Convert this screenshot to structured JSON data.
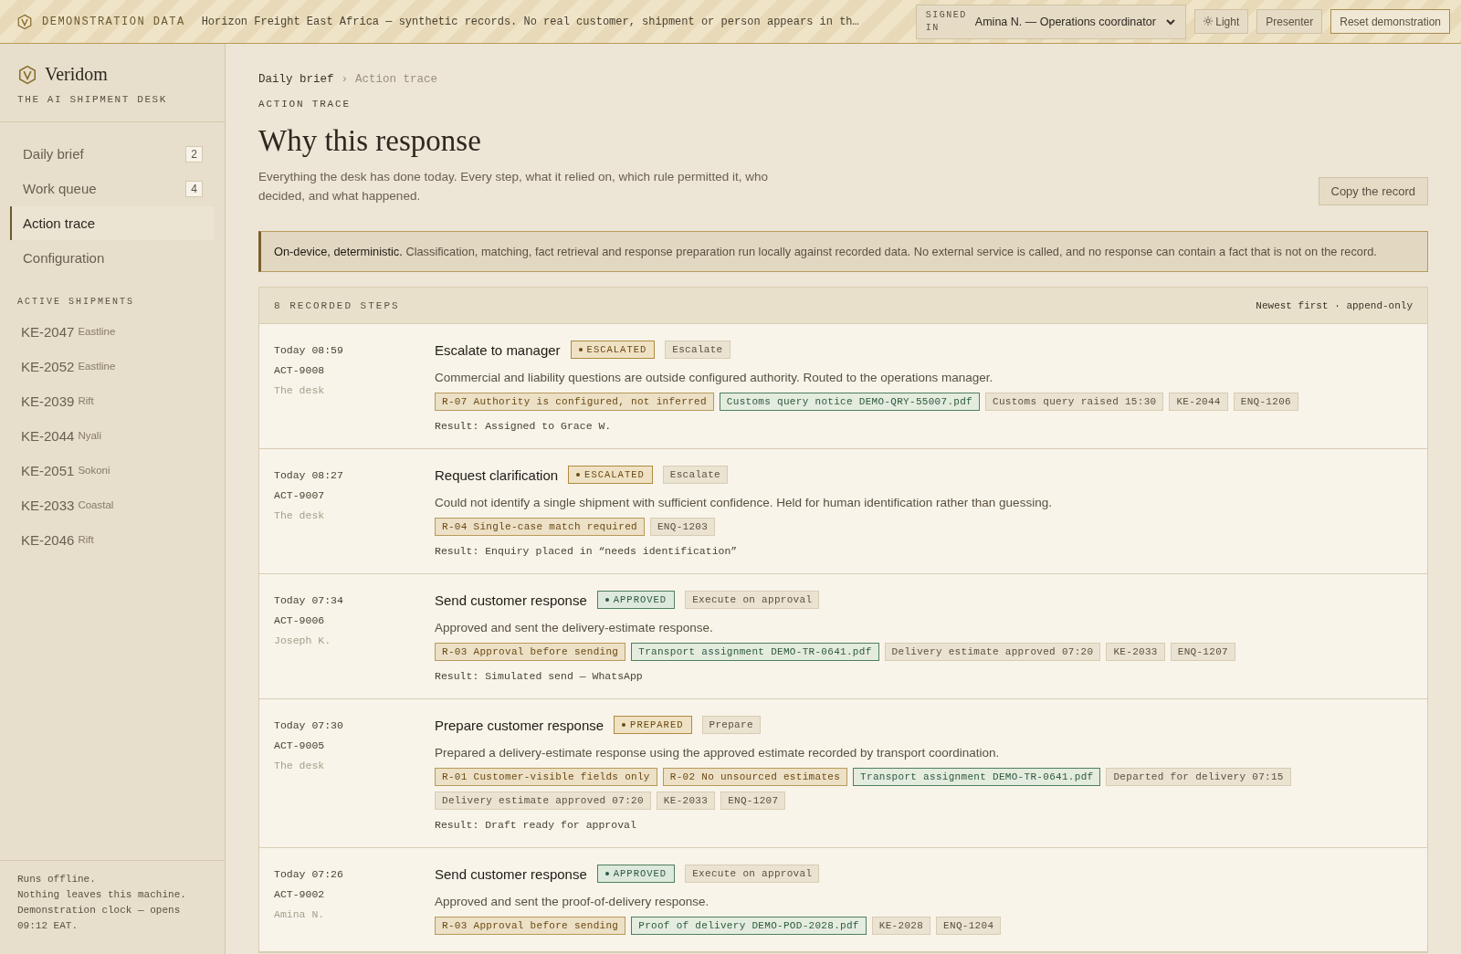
{
  "banner": {
    "label": "DEMONSTRATION DATA",
    "notice": "Horizon Freight East Africa — synthetic records. No real customer, shipment or person appears in th…",
    "signed_in_label": "SIGNED IN",
    "user": "Amina N. — Operations coordinator",
    "theme_button": "Light",
    "buttons": [
      "Presenter",
      "Reset demonstration"
    ]
  },
  "sidebar": {
    "brand": "Veridom",
    "tagline": "THE AI SHIPMENT DESK",
    "nav": [
      {
        "label": "Daily brief",
        "count": "2",
        "selected": false
      },
      {
        "label": "Work queue",
        "count": "4",
        "selected": false
      },
      {
        "label": "Action trace",
        "selected": true
      },
      {
        "label": "Configuration",
        "selected": false
      }
    ],
    "shipments_heading": "ACTIVE SHIPMENTS",
    "shipments": [
      {
        "code": "KE-2047",
        "region": "Eastline"
      },
      {
        "code": "KE-2052",
        "region": "Eastline"
      },
      {
        "code": "KE-2039",
        "region": "Rift"
      },
      {
        "code": "KE-2044",
        "region": "Nyali"
      },
      {
        "code": "KE-2051",
        "region": "Sokoni"
      },
      {
        "code": "KE-2033",
        "region": "Coastal"
      },
      {
        "code": "KE-2046",
        "region": "Rift"
      }
    ],
    "footer": [
      "Runs offline.",
      "Nothing leaves this machine.",
      "Demonstration clock — opens 09:12 EAT."
    ]
  },
  "breadcrumb": [
    {
      "label": "Daily brief"
    },
    {
      "label": "Action trace"
    }
  ],
  "breadcrumb_separator": "›",
  "eyebrow": "ACTION TRACE",
  "title": "Why this response",
  "intro": "Everything the desk has done today. Every step, what it relied on, which rule permitted it, who decided, and what happened.",
  "copy_button": "Copy the record",
  "notice": "**On-device, deterministic.** Classification, matching, fact retrieval and response preparation run locally against recorded data. No external service is called, and no response can contain a fact that is not on the record.",
  "steps_panel": {
    "heading": "8 RECORDED STEPS",
    "order": "Newest first · append-only",
    "steps": [
      {
        "time": "Today 08:59",
        "id": "ACT-9008",
        "actor": "The desk",
        "title": "Escalate to manager",
        "status": {
          "label": "ESCALATED",
          "kind": "escalated"
        },
        "action": "Escalate",
        "description": "Commercial and liability questions are outside configured authority. Routed to the operations manager.",
        "chips": [
          {
            "kind": "rule",
            "text": "R-07 Authority is configured, not inferred"
          },
          {
            "kind": "document",
            "text": "Customs query notice DEMO-QRY-55007.pdf"
          },
          {
            "kind": "fact",
            "text": "Customs query raised 15:30"
          },
          {
            "kind": "fact",
            "text": "KE-2044"
          },
          {
            "kind": "fact",
            "text": "ENQ-1206"
          }
        ],
        "result": "Result: Assigned to Grace W."
      },
      {
        "time": "Today 08:27",
        "id": "ACT-9007",
        "actor": "The desk",
        "title": "Request clarification",
        "status": {
          "label": "ESCALATED",
          "kind": "escalated"
        },
        "action": "Escalate",
        "description": "Could not identify a single shipment with sufficient confidence. Held for human identification rather than guessing.",
        "chips": [
          {
            "kind": "rule",
            "text": "R-04 Single-case match required"
          },
          {
            "kind": "fact",
            "text": "ENQ-1203"
          }
        ],
        "result": "Result: Enquiry placed in “needs identification”"
      },
      {
        "time": "Today 07:34",
        "id": "ACT-9006",
        "actor": "Joseph K.",
        "title": "Send customer response",
        "status": {
          "label": "APPROVED",
          "kind": "approved"
        },
        "action": "Execute on approval",
        "description": "Approved and sent the delivery-estimate response.",
        "chips": [
          {
            "kind": "rule",
            "text": "R-03 Approval before sending"
          },
          {
            "kind": "document",
            "text": "Transport assignment DEMO-TR-0641.pdf"
          },
          {
            "kind": "fact",
            "text": "Delivery estimate approved 07:20"
          },
          {
            "kind": "fact",
            "text": "KE-2033"
          },
          {
            "kind": "fact",
            "text": "ENQ-1207"
          }
        ],
        "result": "Result: Simulated send — WhatsApp"
      },
      {
        "time": "Today 07:30",
        "id": "ACT-9005",
        "actor": "The desk",
        "title": "Prepare customer response",
        "status": {
          "label": "PREPARED",
          "kind": "prepared"
        },
        "action": "Prepare",
        "description": "Prepared a delivery-estimate response using the approved estimate recorded by transport coordination.",
        "chips": [
          {
            "kind": "rule",
            "text": "R-01 Customer-visible fields only"
          },
          {
            "kind": "rule",
            "text": "R-02 No unsourced estimates"
          },
          {
            "kind": "document",
            "text": "Transport assignment DEMO-TR-0641.pdf"
          },
          {
            "kind": "fact",
            "text": "Departed for delivery 07:15"
          },
          {
            "kind": "fact",
            "text": "Delivery estimate approved 07:20"
          },
          {
            "kind": "fact",
            "text": "KE-2033"
          },
          {
            "kind": "fact",
            "text": "ENQ-1207"
          }
        ],
        "result": "Result: Draft ready for approval"
      },
      {
        "time": "Today 07:26",
        "id": "ACT-9002",
        "actor": "Amina N.",
        "title": "Send customer response",
        "status": {
          "label": "APPROVED",
          "kind": "approved"
        },
        "action": "Execute on approval",
        "description": "Approved and sent the proof-of-delivery response.",
        "chips": [
          {
            "kind": "rule",
            "text": "R-03 Approval before sending"
          },
          {
            "kind": "document",
            "text": "Proof of delivery DEMO-POD-2028.pdf"
          },
          {
            "kind": "fact",
            "text": "KE-2028"
          },
          {
            "kind": "fact",
            "text": "ENQ-1204"
          }
        ]
      }
    ]
  }
}
